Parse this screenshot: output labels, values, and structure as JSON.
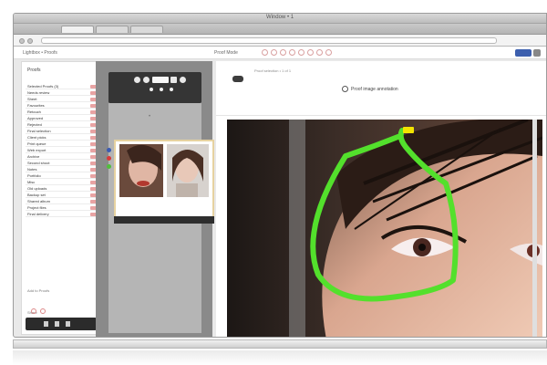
{
  "window": {
    "title": "Window • 1",
    "tabs": [
      "",
      "",
      ""
    ]
  },
  "app": {
    "breadcrumb": "Lightbox • Proofs",
    "mode": "Proof Mode",
    "toolbar_icons": [
      "pen-icon",
      "circle-icon",
      "square-icon",
      "arrow-icon",
      "text-icon",
      "eraser-icon",
      "zoom-icon",
      "share-icon"
    ]
  },
  "sidebar": {
    "title": "Proofs",
    "items": [
      {
        "label": "Selected Proofs (3)",
        "flag": "red"
      },
      {
        "label": "Needs review",
        "flag": "red"
      },
      {
        "label": "Sheet",
        "flag": "red"
      },
      {
        "label": "Favourites",
        "flag": "red"
      },
      {
        "label": "Retouch",
        "flag": "red"
      },
      {
        "label": "Approved",
        "flag": "red"
      },
      {
        "label": "Rejected",
        "flag": "red"
      },
      {
        "label": "Final selection",
        "flag": "red"
      },
      {
        "label": "Client picks",
        "flag": "red"
      },
      {
        "label": "Print queue",
        "flag": "red"
      },
      {
        "label": "Web export",
        "flag": "red"
      },
      {
        "label": "Archive",
        "flag": "red"
      },
      {
        "label": "Second shoot",
        "flag": "red"
      },
      {
        "label": "Notes",
        "flag": "red"
      },
      {
        "label": "Portfolio",
        "flag": "red"
      },
      {
        "label": "Misc",
        "flag": "red"
      },
      {
        "label": "Old uploads",
        "flag": "red"
      },
      {
        "label": "Backup set",
        "flag": "red"
      },
      {
        "label": "Shared album",
        "flag": "red"
      },
      {
        "label": "Project files",
        "flag": "red"
      },
      {
        "label": "Final delivery",
        "flag": "red"
      }
    ],
    "footer_label": "Add to Proofs",
    "footer_label_2": "Share",
    "dock_icons": [
      "phone-icon",
      "signal-icon",
      "card-icon"
    ]
  },
  "filmstrip": {
    "marker": "•"
  },
  "viewer": {
    "caption": "Proof selection • 1 of 1",
    "title": "Proof image annotation",
    "annotation_color": "#53e02c",
    "highlight_color": "#f2e400"
  },
  "colors": {
    "accent": "#3c5fae",
    "flag": "#e8a3a3",
    "panel_dark": "#353535",
    "panel_gray": "#8a8a8a"
  }
}
